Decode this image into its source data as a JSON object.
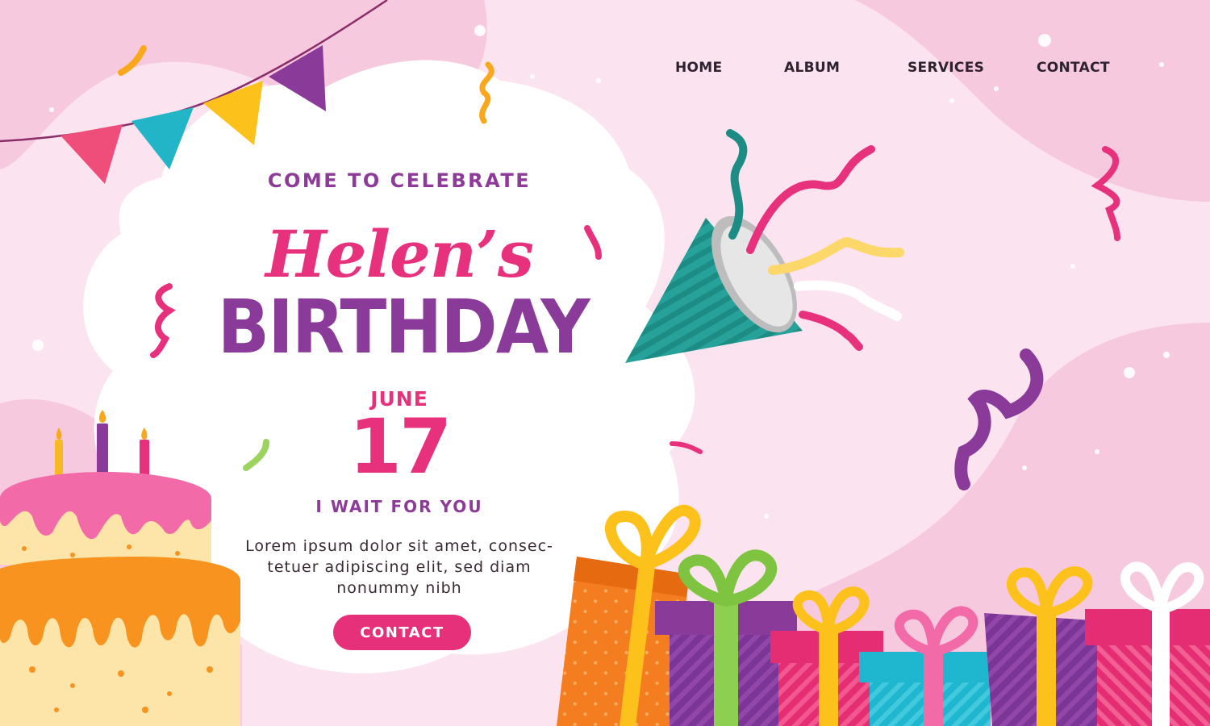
{
  "nav": {
    "home": "HOME",
    "album": "ALBUM",
    "services": "SERVICES",
    "contact": "CONTACT"
  },
  "hero": {
    "intro": "COME TO CELEBRATE",
    "name": "Helen’s",
    "occasion": "BIRTHDAY",
    "month": "JUNE",
    "day": "17",
    "tagline": "I WAIT FOR YOU",
    "body_lines": [
      "Lorem ipsum dolor sit amet, consec-",
      "tetuer adipiscing elit, sed diam",
      "nonummy nibh"
    ],
    "cta_label": "CONTACT"
  },
  "icons": {
    "bunting": "bunting-flags-icon",
    "cake": "birthday-cake-icon",
    "popper": "party-popper-icon",
    "gifts": "gift-boxes-icon",
    "confetti": "confetti-icon"
  },
  "colors": {
    "background": "#fbe4ef",
    "wave": "#f7c9de",
    "pink": "#e8317c",
    "purple": "#8a3a99",
    "teal": "#26a29a",
    "orange": "#f47d20",
    "yellow": "#fbbd1b",
    "cyan": "#1fb7d0"
  }
}
